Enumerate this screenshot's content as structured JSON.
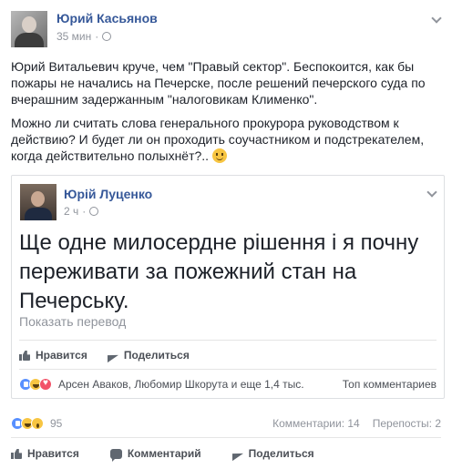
{
  "post": {
    "author": "Юрий Касьянов",
    "time": "35 мин",
    "text_1": "Юрий Витальевич круче, чем \"Правый сектор\". Беспокоится, как бы пожары не начались на Печерске, после решений печерского суда по вчерашним задержанным \"налоговикам Клименко\".",
    "text_2": "Можно ли считать слова генерального прокурора руководством к действию? И будет ли он проходить соучастником и подстрекателем, когда действительно полыхнёт?.."
  },
  "shared": {
    "author": "Юрій Луценко",
    "time": "2 ч",
    "text": "Ще одне милосердне рішення і я почну переживати за пожежний стан на Печерську.",
    "translate": "Показать перевод",
    "like": "Нравится",
    "share": "Поделиться",
    "reactions_text": "Арсен Аваков, Любомир Шкорута и еще 1,4 тыс.",
    "top_comments": "Топ комментариев"
  },
  "footer": {
    "reactions_count": "95",
    "comments": "Комментарии: 14",
    "reposts": "Перепосты: 2",
    "like": "Нравится",
    "comment": "Комментарий",
    "share": "Поделиться"
  }
}
